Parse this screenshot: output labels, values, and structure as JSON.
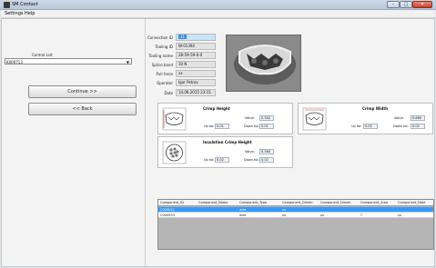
{
  "window": {
    "title": "SM Contact"
  },
  "menu": {
    "settings": "Settings",
    "help": "Help"
  },
  "left": {
    "control_list_label": "Control List",
    "control_list_value": "K000713",
    "continue_label": "Continue >>",
    "back_label": "<< Back"
  },
  "info": {
    "connection_id_label": "Connection ID",
    "connection_id_value": "11",
    "tooling_id_label": "Tooling ID",
    "tooling_id_value": "W-01394",
    "tooling_name_label": "Tooling name",
    "tooling_name_value": "28-59-59-0-0",
    "splice_band_label": "Splice band",
    "splice_band_value": "10 N",
    "pull_force_label": "Pull force",
    "pull_force_value": "xx",
    "operator_label": "Operator",
    "operator_value": "Igor Petrov",
    "date_label": "Date",
    "date_value": "14.08.2015 23:15"
  },
  "crimp_height": {
    "title": "Crimp Height",
    "value_label": "Value:",
    "value": "0.302",
    "up_tol_label": "Up tol:",
    "up_tol": "0.01",
    "down_tol_label": "Down tol:",
    "down_tol": "0.01"
  },
  "crimp_width": {
    "title": "Crimp Width",
    "value_label": "Value:",
    "value": "0.660",
    "up_tol_label": "Up tol:",
    "up_tol": "0.02",
    "down_tol_label": "Down tol:",
    "down_tol": "0.02"
  },
  "insulation": {
    "title": "Insulation Crimp Height",
    "value_label": "Value:",
    "value": "0.560",
    "up_tol_label": "Up tol:",
    "up_tol": "0.02",
    "down_tol_label": "Down tol:",
    "down_tol": "0.02"
  },
  "grid": {
    "columns": [
      "Component_ID",
      "Component_Name",
      "Component_Type",
      "Component_Dimen",
      "Component_Dimen",
      "Component_Area",
      "Component_Note"
    ],
    "rows": [
      [
        "C000012",
        "",
        "wire",
        "xx",
        "",
        "",
        ""
      ],
      [
        "C000533",
        "",
        "wire",
        "xx",
        "xx",
        "?",
        "xx"
      ]
    ]
  },
  "colors": {
    "accent": "#3399ff",
    "selection_field": "#c8e4f8"
  }
}
